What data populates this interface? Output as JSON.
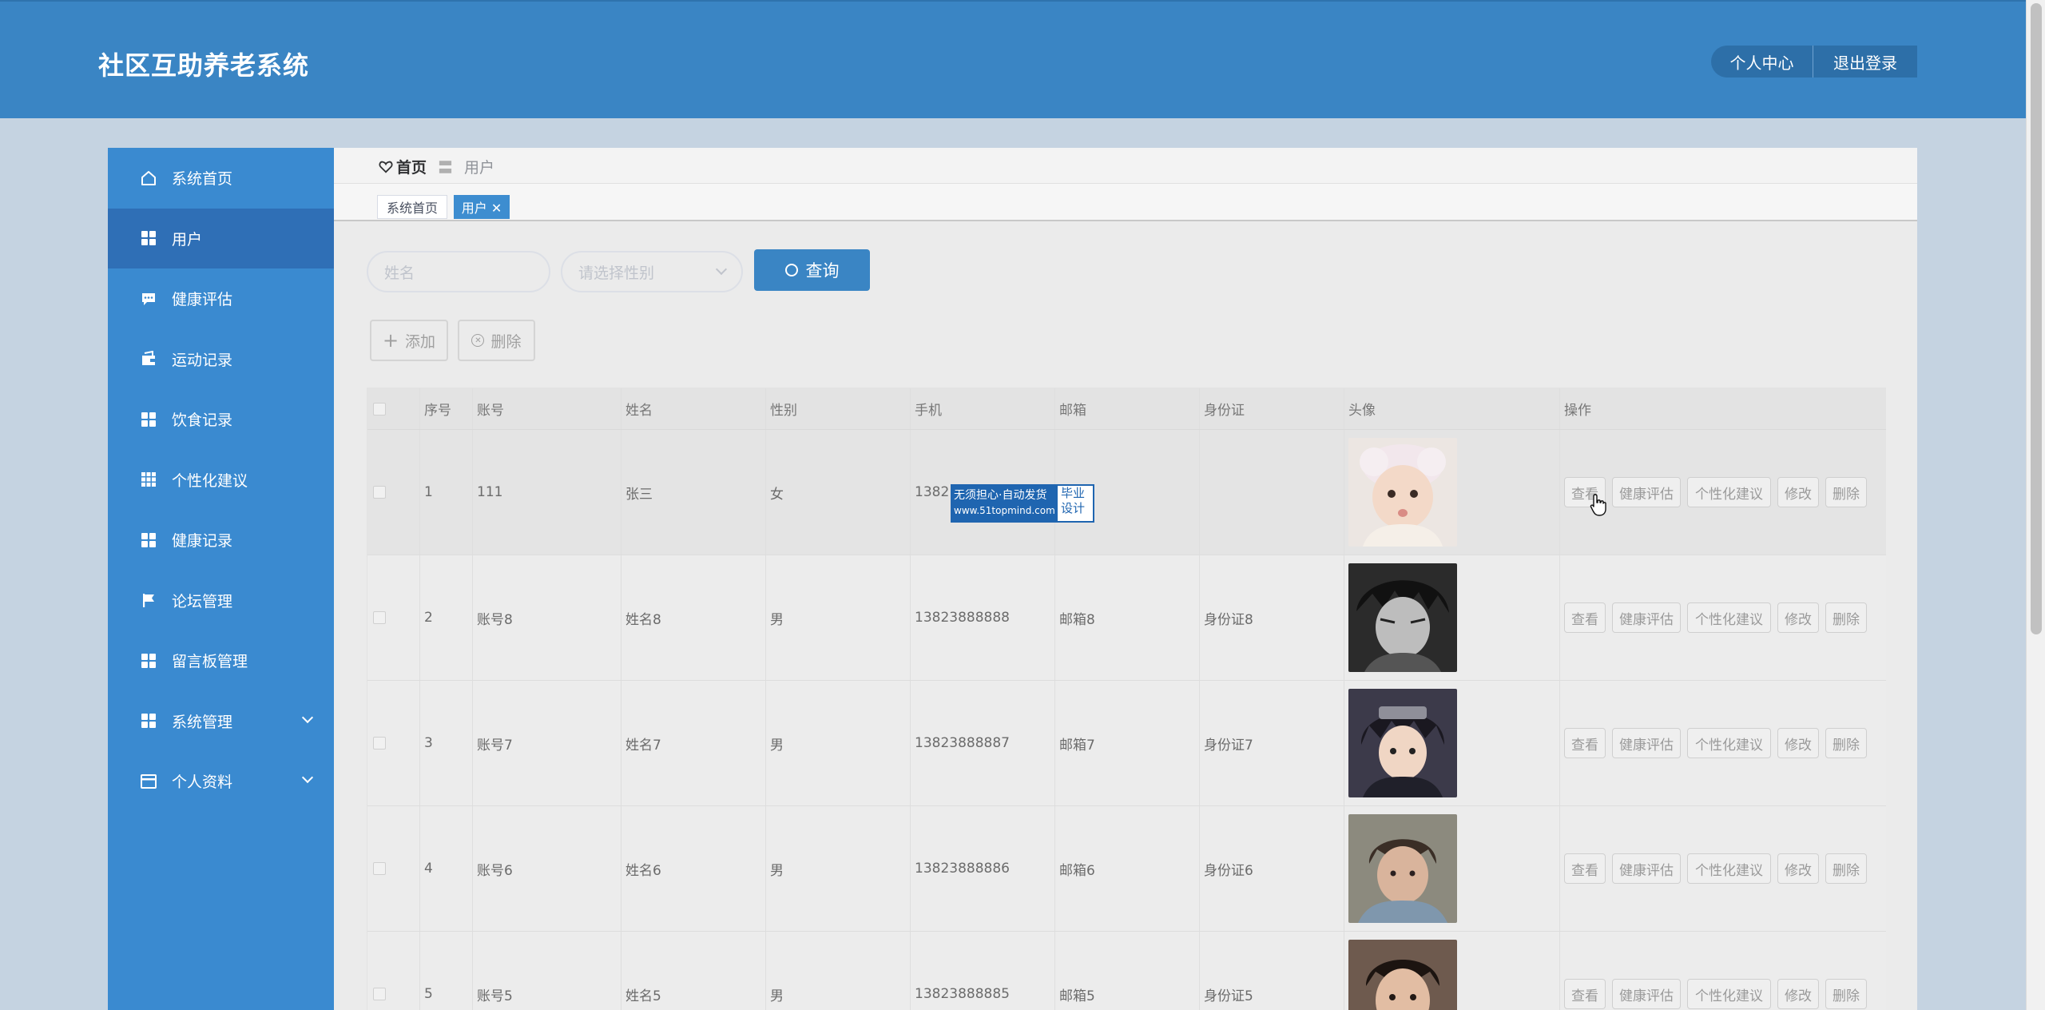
{
  "app": {
    "title": "社区互助养老系统"
  },
  "header": {
    "btn_profile": "个人中心",
    "btn_logout": "退出登录"
  },
  "sidebar": {
    "items": [
      {
        "label": "系统首页",
        "icon": "home-icon"
      },
      {
        "label": "用户",
        "icon": "grid-icon",
        "active": true
      },
      {
        "label": "健康评估",
        "icon": "chat-icon"
      },
      {
        "label": "运动记录",
        "icon": "wallet-icon"
      },
      {
        "label": "饮食记录",
        "icon": "grid-icon"
      },
      {
        "label": "个性化建议",
        "icon": "apps-icon"
      },
      {
        "label": "健康记录",
        "icon": "grid-icon"
      },
      {
        "label": "论坛管理",
        "icon": "flag-icon"
      },
      {
        "label": "留言板管理",
        "icon": "grid-icon"
      },
      {
        "label": "系统管理",
        "icon": "grid-icon",
        "expandable": true
      },
      {
        "label": "个人资料",
        "icon": "card-icon",
        "expandable": true
      }
    ]
  },
  "breadcrumb": {
    "home": "首页",
    "sep": "〓",
    "current": "用户"
  },
  "tabs": [
    {
      "label": "系统首页"
    },
    {
      "label": "用户 ✕"
    }
  ],
  "search": {
    "name_placeholder": "姓名",
    "gender_placeholder": "请选择性别",
    "query_label": "查询"
  },
  "actions": {
    "add_label": "添加",
    "delete_label": "删除"
  },
  "table": {
    "columns": [
      "序号",
      "账号",
      "姓名",
      "性别",
      "手机",
      "邮箱",
      "身份证",
      "头像",
      "操作"
    ],
    "rows": [
      {
        "index": "1",
        "account": "111",
        "name": "张三",
        "gender": "女",
        "phone": "1382",
        "email": "",
        "idcard": ""
      },
      {
        "index": "2",
        "account": "账号8",
        "name": "姓名8",
        "gender": "男",
        "phone": "13823888888",
        "email": "邮箱8",
        "idcard": "身份证8"
      },
      {
        "index": "3",
        "account": "账号7",
        "name": "姓名7",
        "gender": "男",
        "phone": "13823888887",
        "email": "邮箱7",
        "idcard": "身份证7"
      },
      {
        "index": "4",
        "account": "账号6",
        "name": "姓名6",
        "gender": "男",
        "phone": "13823888886",
        "email": "邮箱6",
        "idcard": "身份证6"
      },
      {
        "index": "5",
        "account": "账号5",
        "name": "姓名5",
        "gender": "男",
        "phone": "13823888885",
        "email": "邮箱5",
        "idcard": "身份证5"
      }
    ],
    "ops": {
      "view": "查看",
      "health": "健康评估",
      "advice": "个性化建议",
      "edit": "修改",
      "remove": "删除"
    }
  },
  "watermark": {
    "line1": "无须担心·自动发货",
    "line2": "www.51topmind.com",
    "badge_line1": "毕业",
    "badge_line2": "设计"
  },
  "colors": {
    "header": "#3a85c4",
    "sidebar": "#3a8ad0",
    "sidebar_active": "#2f6fb6",
    "primary_button": "#3a85c4"
  }
}
